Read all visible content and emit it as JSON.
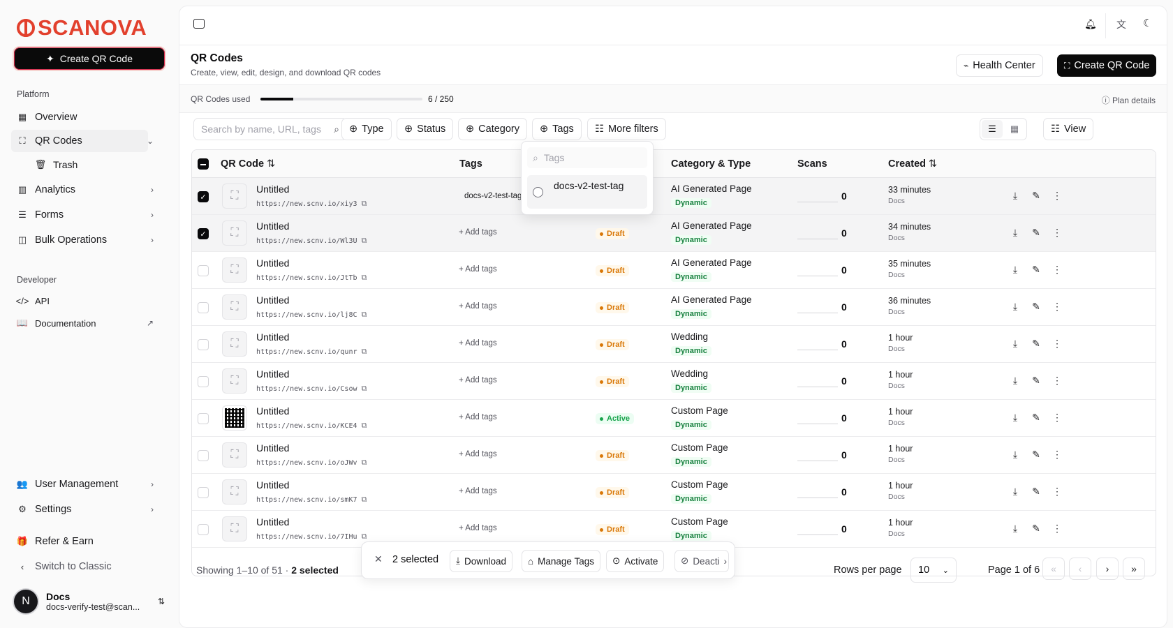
{
  "brand": {
    "name": "SCANOVA"
  },
  "sidebar": {
    "create_label": "Create QR Code",
    "platform_label": "Platform",
    "developer_label": "Developer",
    "items": [
      {
        "label": "Overview"
      },
      {
        "label": "QR Codes"
      },
      {
        "label": "Trash"
      },
      {
        "label": "Analytics"
      },
      {
        "label": "Forms"
      },
      {
        "label": "Bulk Operations"
      },
      {
        "label": "API"
      },
      {
        "label": "Documentation"
      },
      {
        "label": "User Management"
      },
      {
        "label": "Settings"
      },
      {
        "label": "Refer & Earn"
      },
      {
        "label": "Switch to Classic"
      }
    ],
    "user": {
      "initial": "N",
      "name": "Docs",
      "email": "docs-verify-test@scan..."
    }
  },
  "header": {
    "title": "QR Codes",
    "subtitle": "Create, view, edit, design, and download QR codes",
    "health_center_label": "Health Center",
    "create_label": "Create QR Code"
  },
  "usage": {
    "label": "QR Codes used",
    "count": "6 / 250",
    "fraction": 0.024,
    "plan_details": "Plan details"
  },
  "filters": {
    "search_placeholder": "Search by name, URL, tags",
    "type": "Type",
    "status": "Status",
    "category": "Category",
    "tags": "Tags",
    "more": "More filters",
    "view": "View"
  },
  "tags_dropdown": {
    "placeholder": "Tags",
    "option": "docs-v2-test-tag"
  },
  "table": {
    "columns": {
      "qr_code": "QR Code",
      "tags": "Tags",
      "category_type": "Category & Type",
      "scans": "Scans",
      "created": "Created"
    },
    "rows": [
      {
        "name": "Untitled",
        "url": "https://new.scnv.io/xiy3",
        "tag": "docs-v2-test-tag",
        "status": "",
        "category": "AI Generated Page",
        "type": "Dynamic",
        "scans": "0",
        "created": "33 minutes",
        "by": "Docs",
        "checked": true
      },
      {
        "name": "Untitled",
        "url": "https://new.scnv.io/Wl3U",
        "tag": "",
        "status": "Draft",
        "category": "AI Generated Page",
        "type": "Dynamic",
        "scans": "0",
        "created": "34 minutes",
        "by": "Docs",
        "checked": true
      },
      {
        "name": "Untitled",
        "url": "https://new.scnv.io/JtTb",
        "tag": "",
        "status": "Draft",
        "category": "AI Generated Page",
        "type": "Dynamic",
        "scans": "0",
        "created": "35 minutes",
        "by": "Docs",
        "checked": false
      },
      {
        "name": "Untitled",
        "url": "https://new.scnv.io/lj8C",
        "tag": "",
        "status": "Draft",
        "category": "AI Generated Page",
        "type": "Dynamic",
        "scans": "0",
        "created": "36 minutes",
        "by": "Docs",
        "checked": false
      },
      {
        "name": "Untitled",
        "url": "https://new.scnv.io/qunr",
        "tag": "",
        "status": "Draft",
        "category": "Wedding",
        "type": "Dynamic",
        "scans": "0",
        "created": "1 hour",
        "by": "Docs",
        "checked": false
      },
      {
        "name": "Untitled",
        "url": "https://new.scnv.io/Csow",
        "tag": "",
        "status": "Draft",
        "category": "Wedding",
        "type": "Dynamic",
        "scans": "0",
        "created": "1 hour",
        "by": "Docs",
        "checked": false
      },
      {
        "name": "Untitled",
        "url": "https://new.scnv.io/KCE4",
        "tag": "",
        "status": "Active",
        "category": "Custom Page",
        "type": "Dynamic",
        "scans": "0",
        "created": "1 hour",
        "by": "Docs",
        "checked": false
      },
      {
        "name": "Untitled",
        "url": "https://new.scnv.io/oJWv",
        "tag": "",
        "status": "Draft",
        "category": "Custom Page",
        "type": "Dynamic",
        "scans": "0",
        "created": "1 hour",
        "by": "Docs",
        "checked": false
      },
      {
        "name": "Untitled",
        "url": "https://new.scnv.io/smK7",
        "tag": "",
        "status": "Draft",
        "category": "Custom Page",
        "type": "Dynamic",
        "scans": "0",
        "created": "1 hour",
        "by": "Docs",
        "checked": false
      },
      {
        "name": "Untitled",
        "url": "https://new.scnv.io/7IHu",
        "tag": "",
        "status": "Draft",
        "category": "Custom Page",
        "type": "Dynamic",
        "scans": "0",
        "created": "1 hour",
        "by": "Docs",
        "checked": false
      }
    ],
    "add_tags_label": "Add tags"
  },
  "footer": {
    "showing": "Showing 1–10 of 51 ·",
    "selected": "2 selected",
    "rows_per_page_label": "Rows per page",
    "rows_per_page": "10",
    "page": "Page 1 of 6"
  },
  "bulk_bar": {
    "selected": "2 selected",
    "download": "Download",
    "manage_tags": "Manage Tags",
    "activate": "Activate",
    "deactivate": "Deacti"
  },
  "colors": {
    "brand": "#e2402d",
    "draft": "#d97706",
    "active": "#16a34a",
    "dynamic": "#15803d"
  }
}
